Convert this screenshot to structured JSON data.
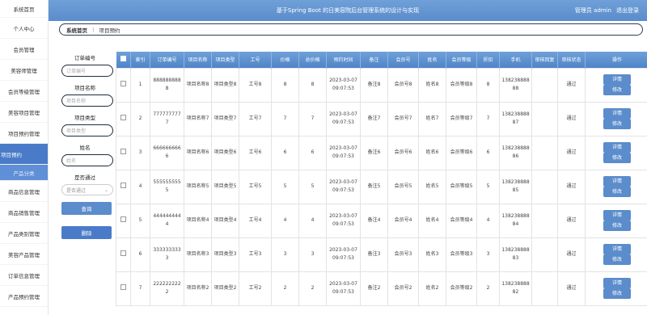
{
  "header": {
    "title": "基于Spring Boot 的日美容院后台管理系统的设计与实现",
    "user": "管理员 admin",
    "logout": "退出登录"
  },
  "sidebar": {
    "items": [
      {
        "label": "系统首页"
      },
      {
        "label": "个人中心"
      },
      {
        "label": "会员管理"
      },
      {
        "label": "美容师管理"
      },
      {
        "label": "会员等级管理"
      },
      {
        "label": "美容项目管理"
      },
      {
        "label": "项目预约管理"
      },
      {
        "label": "项目预约"
      },
      {
        "label": "产品分类"
      },
      {
        "label": "商品信息管理"
      },
      {
        "label": "商品销售管理"
      },
      {
        "label": "产品类别管理"
      },
      {
        "label": "美容产品管理"
      },
      {
        "label": "订单信息管理"
      },
      {
        "label": "产品预约管理"
      }
    ]
  },
  "breadcrumb": {
    "home": "系统首页",
    "sep": "⋮",
    "current": "项目预约"
  },
  "search": {
    "order_label": "订单编号",
    "order_placeholder": "订单编号",
    "name_label": "项目名称",
    "name_placeholder": "项目名称",
    "type_label": "项目类型",
    "type_placeholder": "项目类型",
    "person_label": "姓名",
    "person_placeholder": "姓名",
    "pass_label": "是否通过",
    "pass_placeholder": "是否通过",
    "query_btn": "查询",
    "delete_btn": "删除"
  },
  "table": {
    "headers": [
      "索引",
      "订单编号",
      "项目名称",
      "项目类型",
      "工号",
      "价格",
      "总价格",
      "预约时间",
      "备注",
      "会员号",
      "姓名",
      "会员等级",
      "折扣",
      "手机",
      "审核回复",
      "审核状态",
      "操作"
    ],
    "detail_btn": "详情",
    "edit_btn": "修改",
    "rows": [
      {
        "idx": "1",
        "order": "8888888888",
        "name": "项目名称8",
        "type": "项目类型8",
        "emp": "工号8",
        "price": "8",
        "total": "8",
        "time": "2023-03-07 09:07:53",
        "note": "备注8",
        "member": "会员号8",
        "person": "姓名8",
        "level": "会员等级8",
        "discount": "8",
        "phone": "13823888888",
        "reply": "",
        "status": "通过"
      },
      {
        "idx": "2",
        "order": "7777777777",
        "name": "项目名称7",
        "type": "项目类型7",
        "emp": "工号7",
        "price": "7",
        "total": "7",
        "time": "2023-03-07 09:07:53",
        "note": "备注7",
        "member": "会员号7",
        "person": "姓名7",
        "level": "会员等级7",
        "discount": "7",
        "phone": "13823888887",
        "reply": "",
        "status": "通过"
      },
      {
        "idx": "3",
        "order": "6666666666",
        "name": "项目名称6",
        "type": "项目类型6",
        "emp": "工号6",
        "price": "6",
        "total": "6",
        "time": "2023-03-07 09:07:53",
        "note": "备注6",
        "member": "会员号6",
        "person": "姓名6",
        "level": "会员等级6",
        "discount": "6",
        "phone": "13823888886",
        "reply": "",
        "status": "通过"
      },
      {
        "idx": "4",
        "order": "5555555555",
        "name": "项目名称5",
        "type": "项目类型5",
        "emp": "工号5",
        "price": "5",
        "total": "5",
        "time": "2023-03-07 09:07:53",
        "note": "备注5",
        "member": "会员号5",
        "person": "姓名5",
        "level": "会员等级5",
        "discount": "5",
        "phone": "13823888885",
        "reply": "",
        "status": "通过"
      },
      {
        "idx": "5",
        "order": "4444444444",
        "name": "项目名称4",
        "type": "项目类型4",
        "emp": "工号4",
        "price": "4",
        "total": "4",
        "time": "2023-03-07 09:07:53",
        "note": "备注4",
        "member": "会员号4",
        "person": "姓名4",
        "level": "会员等级4",
        "discount": "4",
        "phone": "13823888884",
        "reply": "",
        "status": "通过"
      },
      {
        "idx": "6",
        "order": "3333333333",
        "name": "项目名称3",
        "type": "项目类型3",
        "emp": "工号3",
        "price": "3",
        "total": "3",
        "time": "2023-03-07 09:07:53",
        "note": "备注3",
        "member": "会员号3",
        "person": "姓名3",
        "level": "会员等级3",
        "discount": "3",
        "phone": "13823888883",
        "reply": "",
        "status": "通过"
      },
      {
        "idx": "7",
        "order": "2222222222",
        "name": "项目名称2",
        "type": "项目类型2",
        "emp": "工号2",
        "price": "2",
        "total": "2",
        "time": "2023-03-07 09:07:53",
        "note": "备注2",
        "member": "会员号2",
        "person": "姓名2",
        "level": "会员等级2",
        "discount": "2",
        "phone": "13823888882",
        "reply": "",
        "status": "通过"
      }
    ]
  }
}
